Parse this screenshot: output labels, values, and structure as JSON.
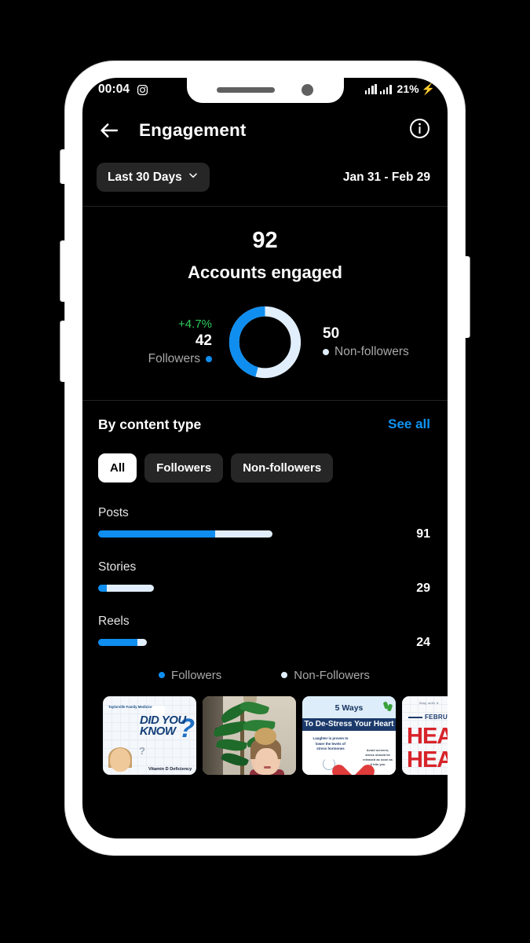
{
  "status_bar": {
    "time": "00:04",
    "app_icon": "instagram-icon",
    "battery_percent": "21%",
    "charging_icon": "lightning-bolt-icon"
  },
  "header": {
    "back_icon": "back-arrow-icon",
    "title": "Engagement",
    "info_icon": "info-circle-icon"
  },
  "range": {
    "preset_label": "Last 30 Days",
    "chevron_icon": "chevron-down-icon",
    "date_range": "Jan 31 - Feb 29"
  },
  "summary": {
    "total_value": "92",
    "total_label": "Accounts engaged",
    "followers": {
      "delta": "+4.7%",
      "value": "42",
      "label": "Followers",
      "color": "#0f8ef0"
    },
    "non_followers": {
      "value": "50",
      "label": "Non-followers",
      "color": "#e1eefb"
    }
  },
  "content_section": {
    "title": "By content type",
    "see_all": "See all",
    "chips": [
      {
        "label": "All",
        "active": true
      },
      {
        "label": "Followers",
        "active": false
      },
      {
        "label": "Non-followers",
        "active": false
      }
    ]
  },
  "legend": [
    {
      "label": "Followers",
      "color": "#0f8ef0"
    },
    {
      "label": "Non-Followers",
      "color": "#e1eefb"
    }
  ],
  "thumbnails": [
    {
      "name": "did-you-know-vitamin-d",
      "brand": "Taylorville Family Medicine",
      "headline": "DID YOU KNOW",
      "caption": "Vitamin D Deficiency"
    },
    {
      "name": "reel-person-with-plant",
      "headline": ""
    },
    {
      "name": "five-ways-de-stress-your-heart",
      "line1": "5 Ways",
      "line2": "To De-Stress Your Heart",
      "note": "Laughter is proven to lower the levels of stress hormones",
      "note2": "Avoid screens; stress should be released as soon as it hits you"
    },
    {
      "name": "february-heart-health",
      "tiny": "Stay with it",
      "month": "FEBRUARY",
      "big1": "HEART",
      "big2": "HEALTH"
    }
  ],
  "chart_data": [
    {
      "type": "pie",
      "title": "Accounts engaged",
      "total": 92,
      "categories": [
        "Followers",
        "Non-followers"
      ],
      "values": [
        42,
        50
      ],
      "colors": [
        "#0f8ef0",
        "#e1eefb"
      ],
      "legend_position": "sides",
      "annotations": [
        "+4.7%"
      ]
    },
    {
      "type": "bar",
      "title": "By content type",
      "orientation": "horizontal",
      "stacked": true,
      "categories": [
        "Posts",
        "Stories",
        "Reels"
      ],
      "totals": [
        91,
        29,
        24
      ],
      "series": [
        {
          "name": "Followers",
          "color": "#0f8ef0",
          "values": [
            61,
            4,
            19
          ]
        },
        {
          "name": "Non-Followers",
          "color": "#e1eefb",
          "values": [
            30,
            25,
            5
          ]
        }
      ],
      "bar_pixel_widths": [
        222,
        71,
        62
      ],
      "followers_fraction": [
        0.67,
        0.15,
        0.8
      ],
      "xlabel": "",
      "ylabel": "",
      "grid": false,
      "legend_position": "bottom"
    }
  ],
  "bars": [
    {
      "name": "Posts",
      "value": "91",
      "track_width": 222,
      "followers_pct": 67
    },
    {
      "name": "Stories",
      "value": "29",
      "track_width": 71,
      "followers_pct": 15
    },
    {
      "name": "Reels",
      "value": "24",
      "track_width": 62,
      "followers_pct": 80
    }
  ]
}
